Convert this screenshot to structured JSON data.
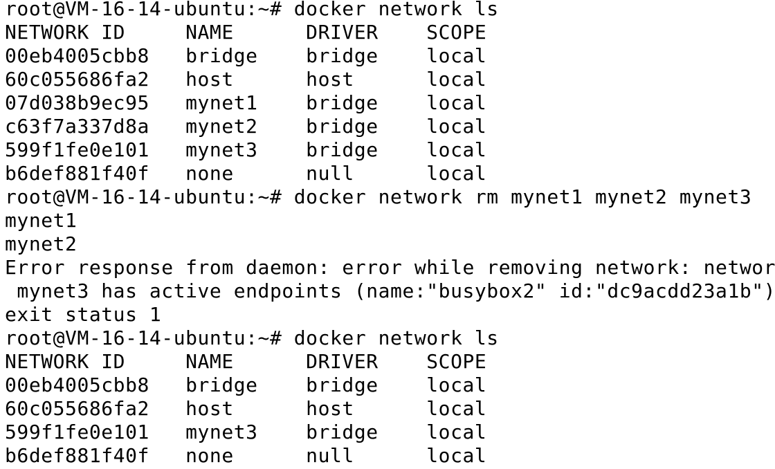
{
  "terminal": {
    "lines": [
      "root@VM-16-14-ubuntu:~# docker network ls",
      "NETWORK ID     NAME      DRIVER    SCOPE",
      "00eb4005cbb8   bridge    bridge    local",
      "60c055686fa2   host      host      local",
      "07d038b9ec95   mynet1    bridge    local",
      "c63f7a337d8a   mynet2    bridge    local",
      "599f1fe0e101   mynet3    bridge    local",
      "b6def881f40f   none      null      local",
      "root@VM-16-14-ubuntu:~# docker network rm mynet1 mynet2 mynet3",
      "mynet1",
      "mynet2",
      "Error response from daemon: error while removing network: network",
      " mynet3 has active endpoints (name:\"busybox2\" id:\"dc9acdd23a1b\")",
      "exit status 1",
      "root@VM-16-14-ubuntu:~# docker network ls",
      "NETWORK ID     NAME      DRIVER    SCOPE",
      "00eb4005cbb8   bridge    bridge    local",
      "60c055686fa2   host      host      local",
      "599f1fe0e101   mynet3    bridge    local",
      "b6def881f40f   none      null      local"
    ]
  }
}
